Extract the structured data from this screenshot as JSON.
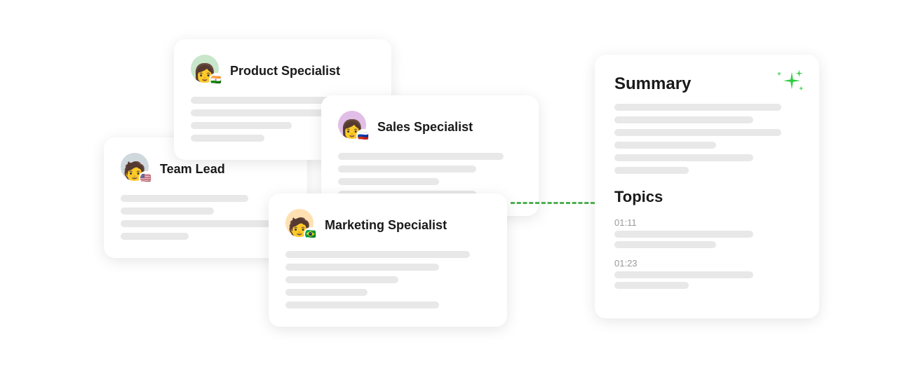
{
  "cards": {
    "product_specialist": {
      "title": "Product Specialist",
      "flag": "🇮🇳",
      "avatar_color": "#c8e6c9"
    },
    "team_lead": {
      "title": "Team Lead",
      "flag": "🇺🇸",
      "avatar_color": "#cfd8dc"
    },
    "sales_specialist": {
      "title": "Sales Specialist",
      "flag": "🇷🇺",
      "avatar_color": "#e1bee7"
    },
    "marketing_specialist": {
      "title": "Marketing Specialist",
      "flag": "🇧🇷",
      "avatar_color": "#ffe0b2"
    }
  },
  "summary": {
    "title": "Summary",
    "topics_title": "Topics",
    "topic1_time": "01:11",
    "topic2_time": "01:23"
  },
  "sparkle": {
    "label": "AI sparkle icon"
  }
}
